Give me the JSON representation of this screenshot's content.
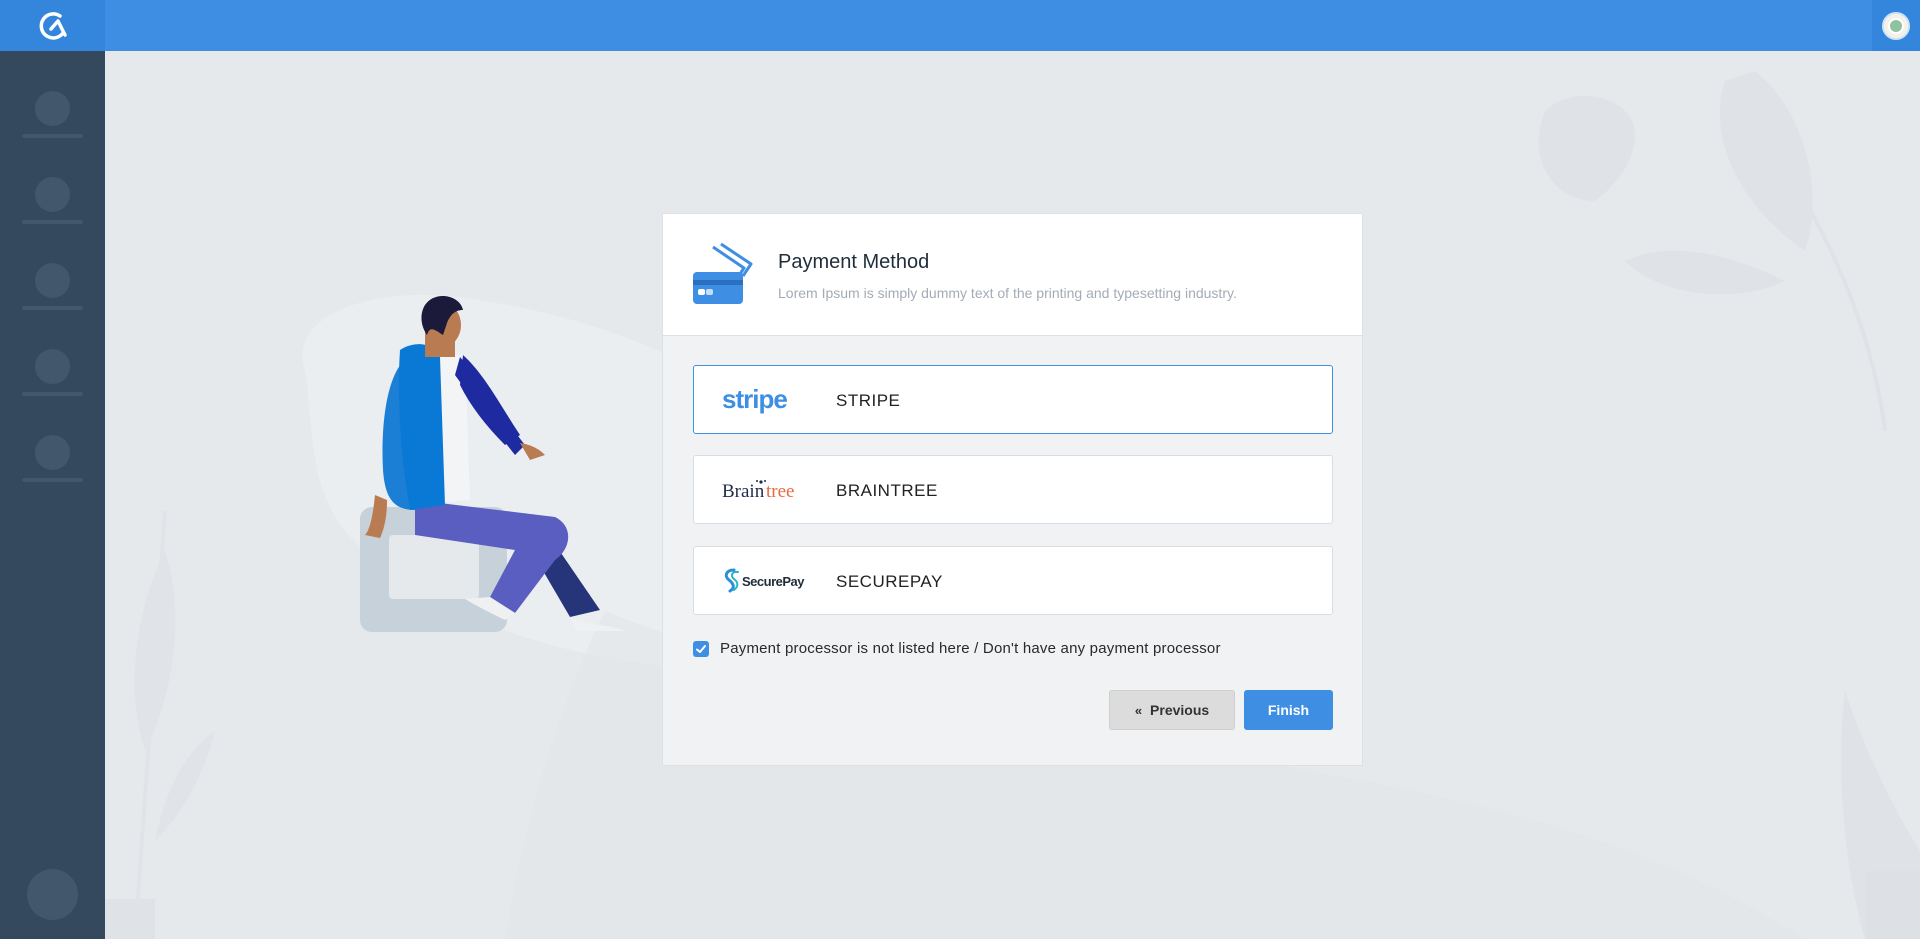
{
  "sidebar": {
    "items": [
      {
        "id": "nav-1"
      },
      {
        "id": "nav-2"
      },
      {
        "id": "nav-3"
      },
      {
        "id": "nav-4"
      },
      {
        "id": "nav-5"
      }
    ]
  },
  "card": {
    "title": "Payment Method",
    "subtitle": "Lorem Ipsum is simply dummy text of the printing and  typesetting industry."
  },
  "options": [
    {
      "brand": "stripe",
      "label": "STRIPE",
      "selected": true
    },
    {
      "brand": "Braintree",
      "label": "BRAINTREE",
      "selected": false
    },
    {
      "brand": "SecurePay",
      "label": "SECUREPAY",
      "selected": false
    }
  ],
  "checkbox": {
    "label": "Payment processor is not listed here / Don't have any payment processor",
    "checked": true
  },
  "buttons": {
    "previous": "Previous",
    "finish": "Finish"
  },
  "colors": {
    "accent": "#3e8fe3",
    "sidebar": "#34495e",
    "background": "#e6e9ec",
    "braintree_tree": "#e86a3c"
  },
  "icons": {
    "logo": "app-logo-icon",
    "avatar": "user-avatar-icon",
    "card": "credit-card-icon",
    "previous": "double-chevron-left-icon",
    "check": "check-icon"
  }
}
